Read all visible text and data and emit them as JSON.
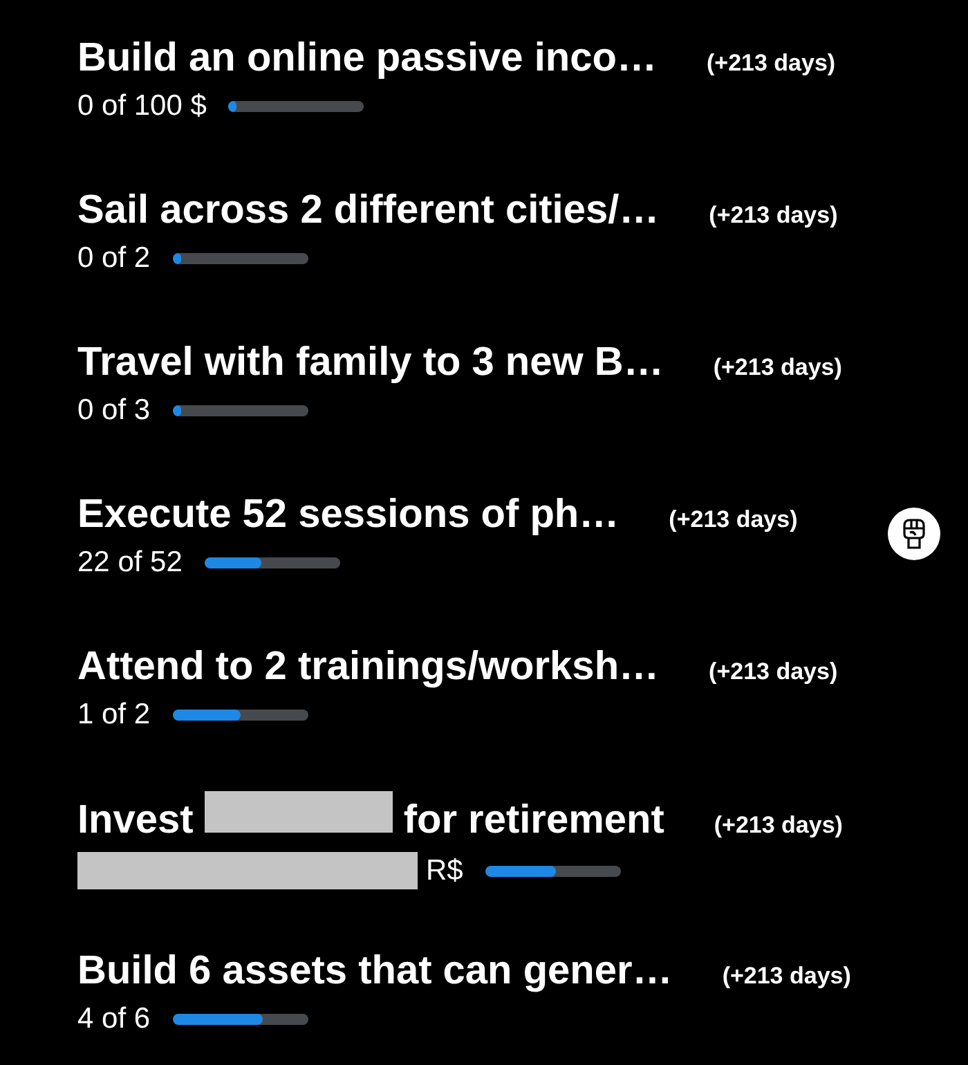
{
  "goals": [
    {
      "title_parts": [
        {
          "kind": "text",
          "text": "Build an online passive inco…"
        }
      ],
      "days": "(+213 days)",
      "progress_parts": [
        {
          "kind": "text",
          "text": "0 of 100 $"
        }
      ],
      "level": 0
    },
    {
      "title_parts": [
        {
          "kind": "text",
          "text": "Sail across 2 different cities/…"
        }
      ],
      "days": "(+213 days)",
      "progress_parts": [
        {
          "kind": "text",
          "text": "0 of 2"
        }
      ],
      "level": 0
    },
    {
      "title_parts": [
        {
          "kind": "text",
          "text": "Travel with family to 3 new B…"
        }
      ],
      "days": "(+213 days)",
      "progress_parts": [
        {
          "kind": "text",
          "text": "0 of 3"
        }
      ],
      "level": 0
    },
    {
      "title_parts": [
        {
          "kind": "text",
          "text": "Execute 52 sessions of ph…"
        }
      ],
      "days": "(+213 days)",
      "progress_parts": [
        {
          "kind": "text",
          "text": "22 of 52"
        }
      ],
      "level": 0.42,
      "has_badge": true
    },
    {
      "title_parts": [
        {
          "kind": "text",
          "text": "Attend to 2 trainings/worksh…"
        }
      ],
      "days": "(+213 days)",
      "progress_parts": [
        {
          "kind": "text",
          "text": "1 of 2"
        }
      ],
      "level": 0.5
    },
    {
      "title_parts": [
        {
          "kind": "text",
          "text": "Invest"
        },
        {
          "kind": "redacted"
        },
        {
          "kind": "text",
          "text": "for retirement"
        }
      ],
      "days": "(+213 days)",
      "progress_parts": [
        {
          "kind": "redacted"
        },
        {
          "kind": "text",
          "text": "R$"
        }
      ],
      "level": 0.52
    },
    {
      "title_parts": [
        {
          "kind": "text",
          "text": "Build 6 assets that can gener…"
        }
      ],
      "days": "(+213 days)",
      "progress_parts": [
        {
          "kind": "text",
          "text": "4 of 6"
        }
      ],
      "level": 0.67
    }
  ]
}
